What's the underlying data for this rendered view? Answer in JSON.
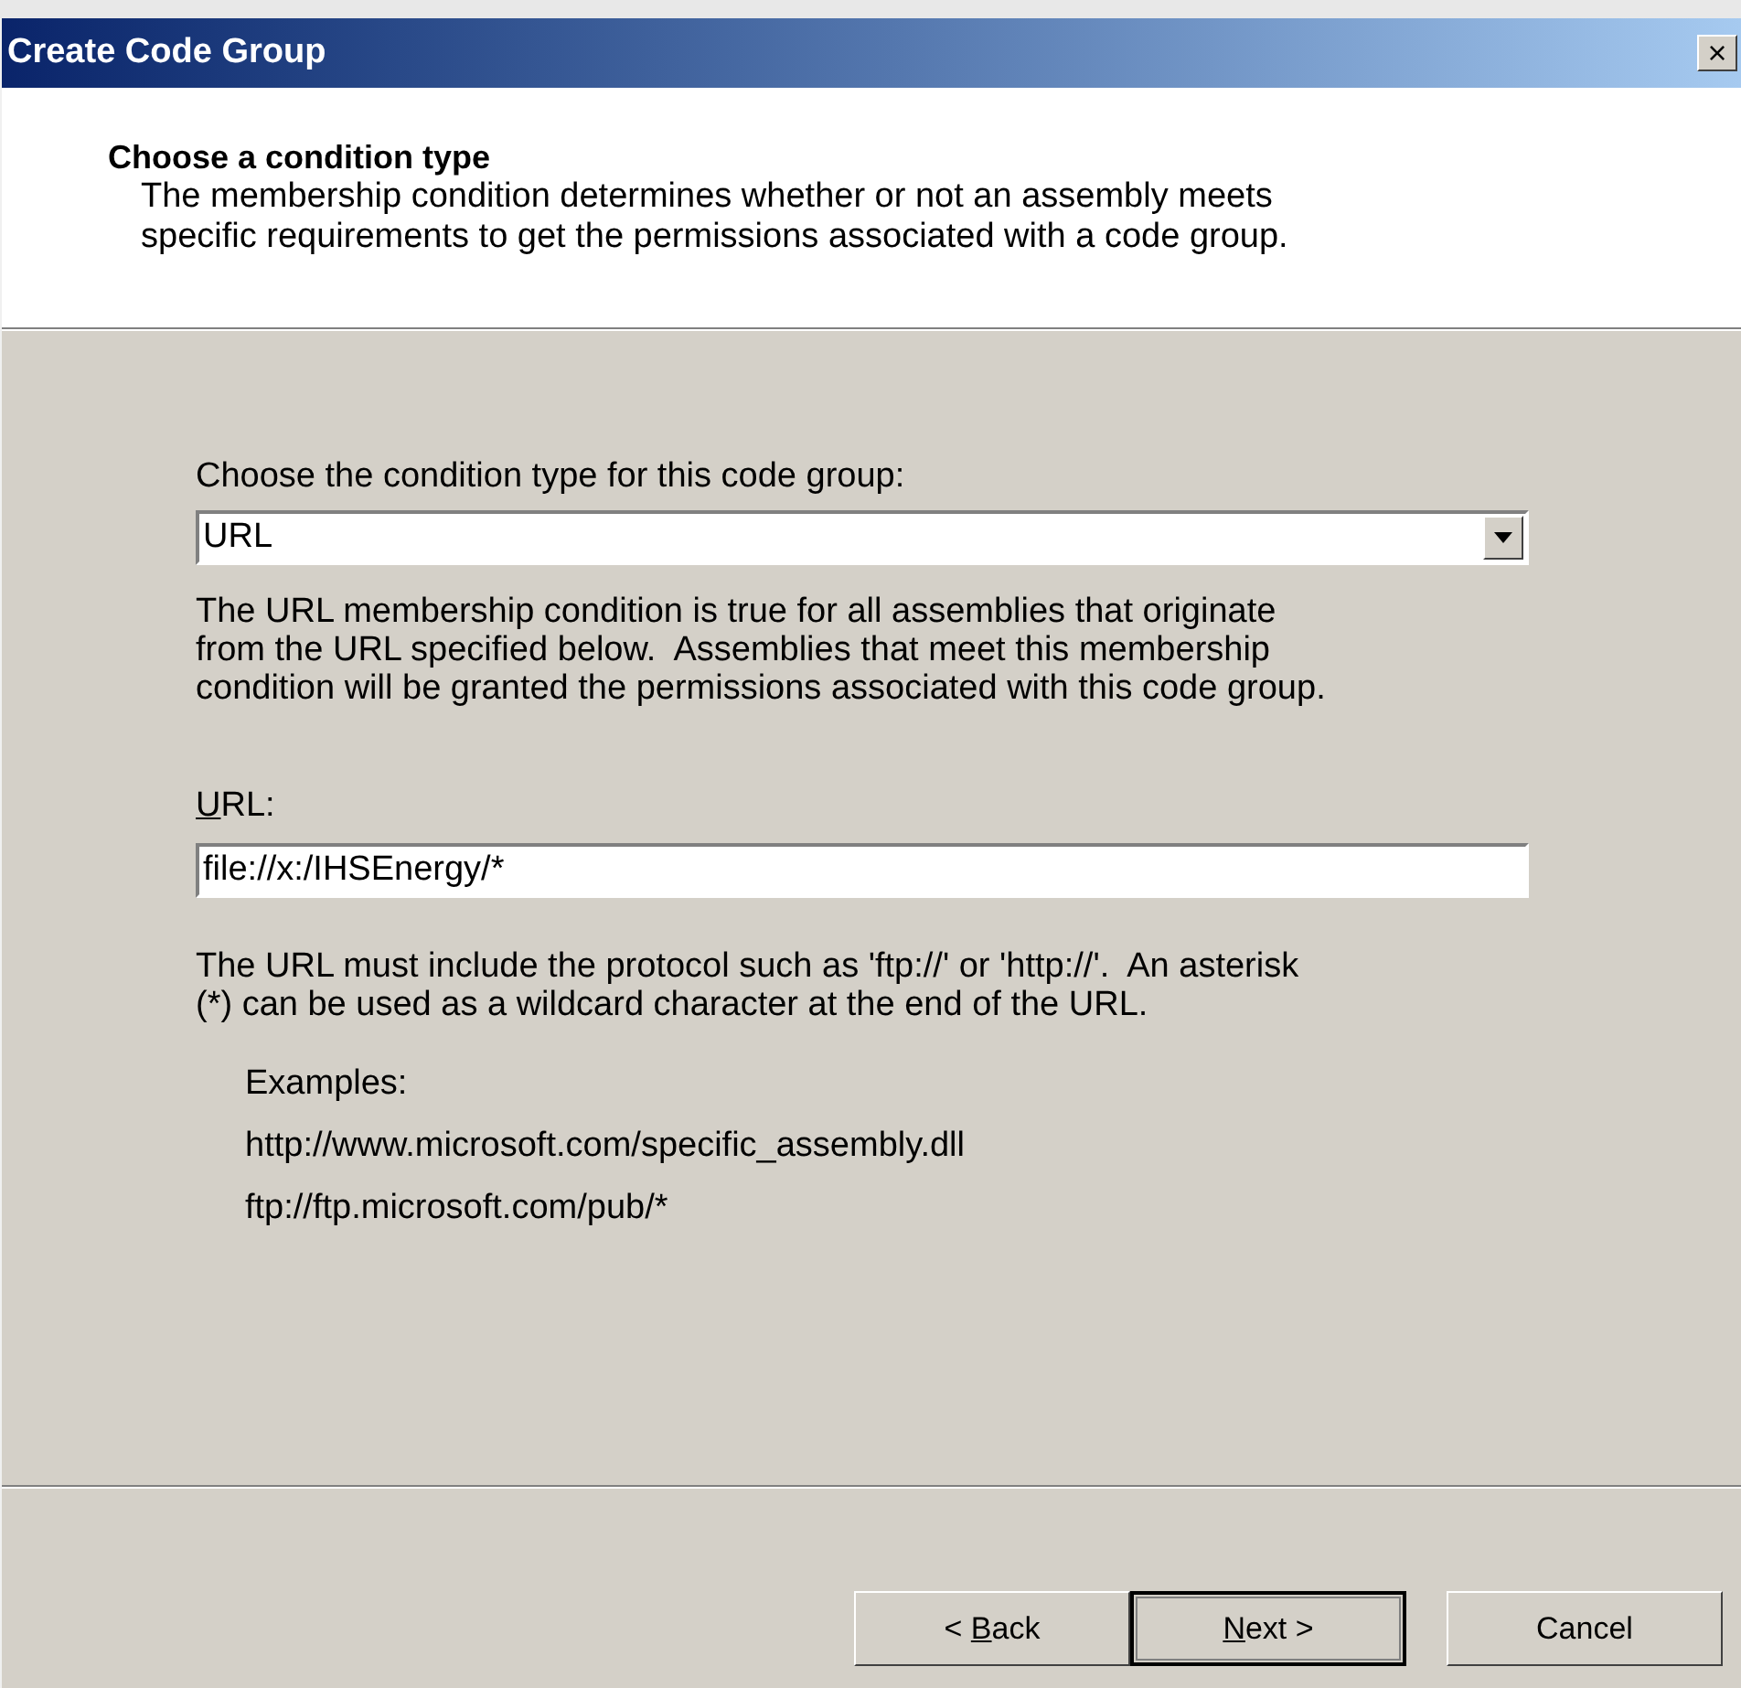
{
  "window": {
    "title": "Create Code Group",
    "close": "×"
  },
  "header": {
    "title": "Choose a condition type",
    "description": "The membership condition determines whether or not an assembly meets specific requirements to get the permissions associated with a code group."
  },
  "condition": {
    "label": "Choose the condition type for this code group:",
    "value": "URL"
  },
  "condition_description": "The URL membership condition is true for all assemblies that originate from the URL specified below.  Assemblies that meet this membership condition will be granted the permissions associated with this code group.",
  "url": {
    "label": "URL:",
    "mnemonic": true,
    "value": "file://x:/IHSEnergy/*"
  },
  "url_help": "The URL must include the protocol such as 'ftp://' or 'http://'.  An asterisk (*) can be used as a wildcard character at the end of the URL.",
  "examples": [
    "Examples:",
    "http://www.microsoft.com/specific_assembly.dll",
    "ftp://ftp.microsoft.com/pub/*"
  ],
  "buttons": [
    {
      "label": "< Back",
      "mnemonic": true,
      "default": false
    },
    {
      "label": "Next >",
      "mnemonic": true,
      "default": true
    },
    {
      "label": "Cancel",
      "mnemonic": false,
      "default": false
    }
  ]
}
